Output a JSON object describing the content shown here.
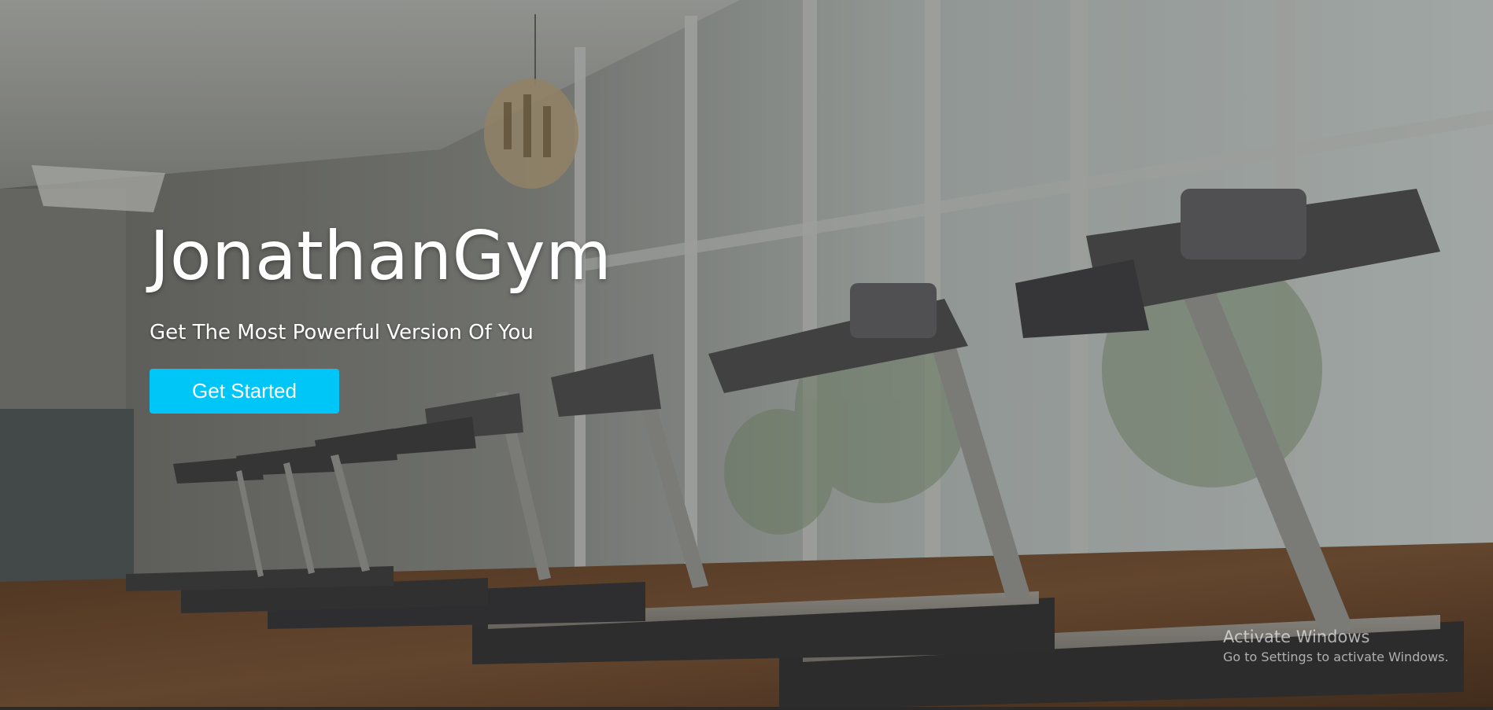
{
  "hero": {
    "title": "JonathanGym",
    "subtitle": "Get The Most Powerful Version Of You",
    "cta_label": "Get Started",
    "cta_color": "#00c6f7",
    "background_image": "gym interior with rows of treadmills facing floor-to-ceiling windows"
  },
  "watermark": {
    "title": "Activate Windows",
    "subtitle": "Go to Settings to activate Windows."
  }
}
